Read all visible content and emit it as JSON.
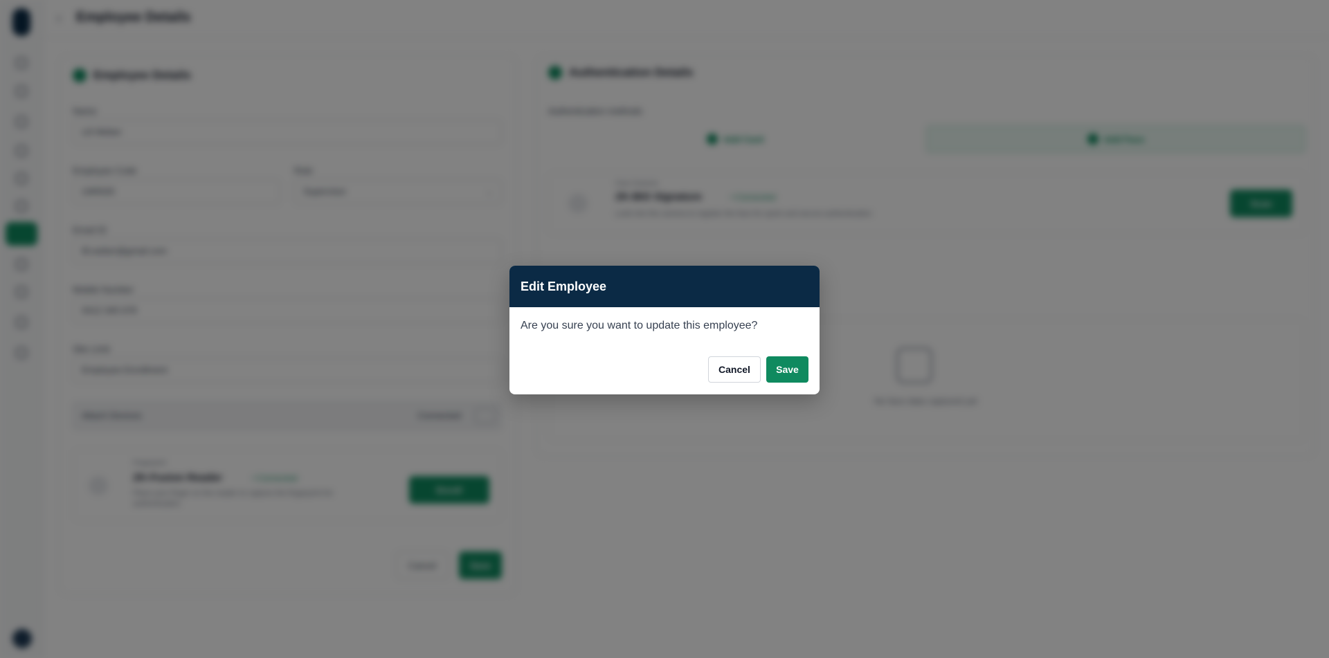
{
  "colors": {
    "header_navy": "#0b2a45",
    "accent_green": "#0f8a5f",
    "overlay": "rgba(0,0,0,0.49)"
  },
  "background": {
    "header_title": "Employee Details",
    "employee_section": {
      "title": "Employee Details",
      "name_label": "Name",
      "name_value": "Lili Weber",
      "employee_id_label": "Employee Code",
      "employee_id_value": "LW0026",
      "role_label": "Role",
      "role_value": "Supervisor",
      "email_label": "Email ID",
      "email_value": "lili.weber@gmail.com",
      "mobile_label": "Mobile Number",
      "mobile_value": "0412 345 678",
      "site_label": "Site Limit",
      "site_value": "Employee Enrollment",
      "strip_label": "Attach Devices",
      "strip_right": "Connected",
      "device_small": "Fingerprint",
      "device_name": "ZK-Fusion Reader",
      "device_status": "• Connected",
      "device_desc": "Place your finger on the reader to capture the fingerprint for authentication",
      "device_button": "Enroll",
      "cancel_label": "Cancel",
      "save_label": "Save"
    },
    "auth_section": {
      "title": "Authentication Details",
      "methods_label": "Authentication methods",
      "tab_1": "Add Card",
      "tab_2": "Add Face",
      "device_small": "Face Scanner",
      "device_name": "ZK-BIO Signature",
      "device_status": "• Connected",
      "device_desc": "Look into the camera to register the face for quick and secure authentication",
      "device_button": "Scan",
      "empty_text": "No face data captured yet"
    }
  },
  "modal": {
    "title": "Edit Employee",
    "message": "Are you sure you want to update this employee?",
    "cancel_label": "Cancel",
    "save_label": "Save"
  }
}
